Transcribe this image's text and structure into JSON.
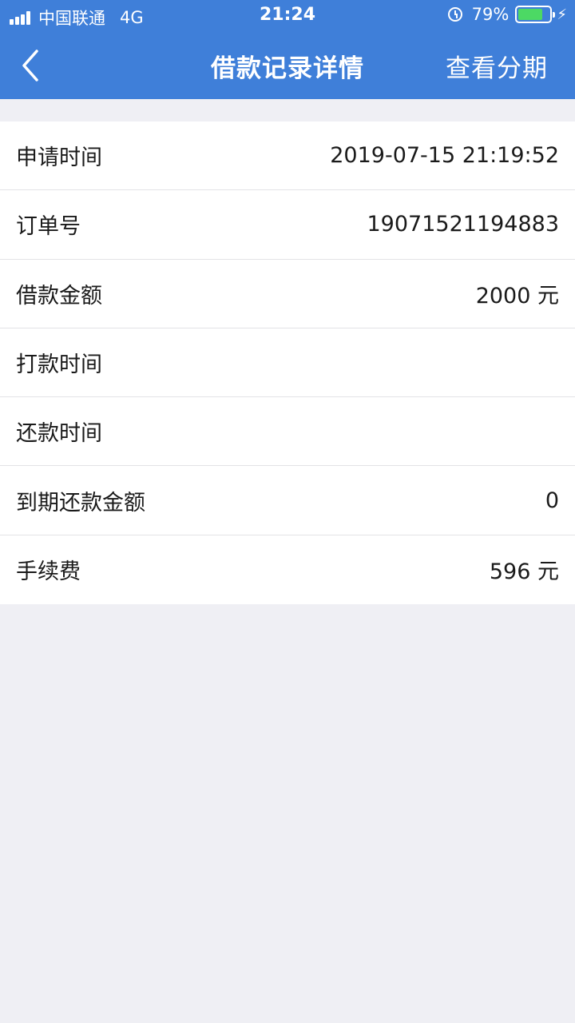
{
  "status_bar": {
    "carrier": "中国联通",
    "network": "4G",
    "time": "21:24",
    "battery": "79%"
  },
  "nav": {
    "title": "借款记录详情",
    "action": "查看分期"
  },
  "details": [
    {
      "label": "申请时间",
      "value": "2019-07-15 21:19:52"
    },
    {
      "label": "订单号",
      "value": "19071521194883"
    },
    {
      "label": "借款金额",
      "value": "2000 元"
    },
    {
      "label": "打款时间",
      "value": ""
    },
    {
      "label": "还款时间",
      "value": ""
    },
    {
      "label": "到期还款金额",
      "value": "0"
    },
    {
      "label": "手续费",
      "value": "596 元"
    }
  ],
  "colors": {
    "header": "#3f7fd9",
    "background": "#efeff4",
    "battery": "#4cd964"
  }
}
